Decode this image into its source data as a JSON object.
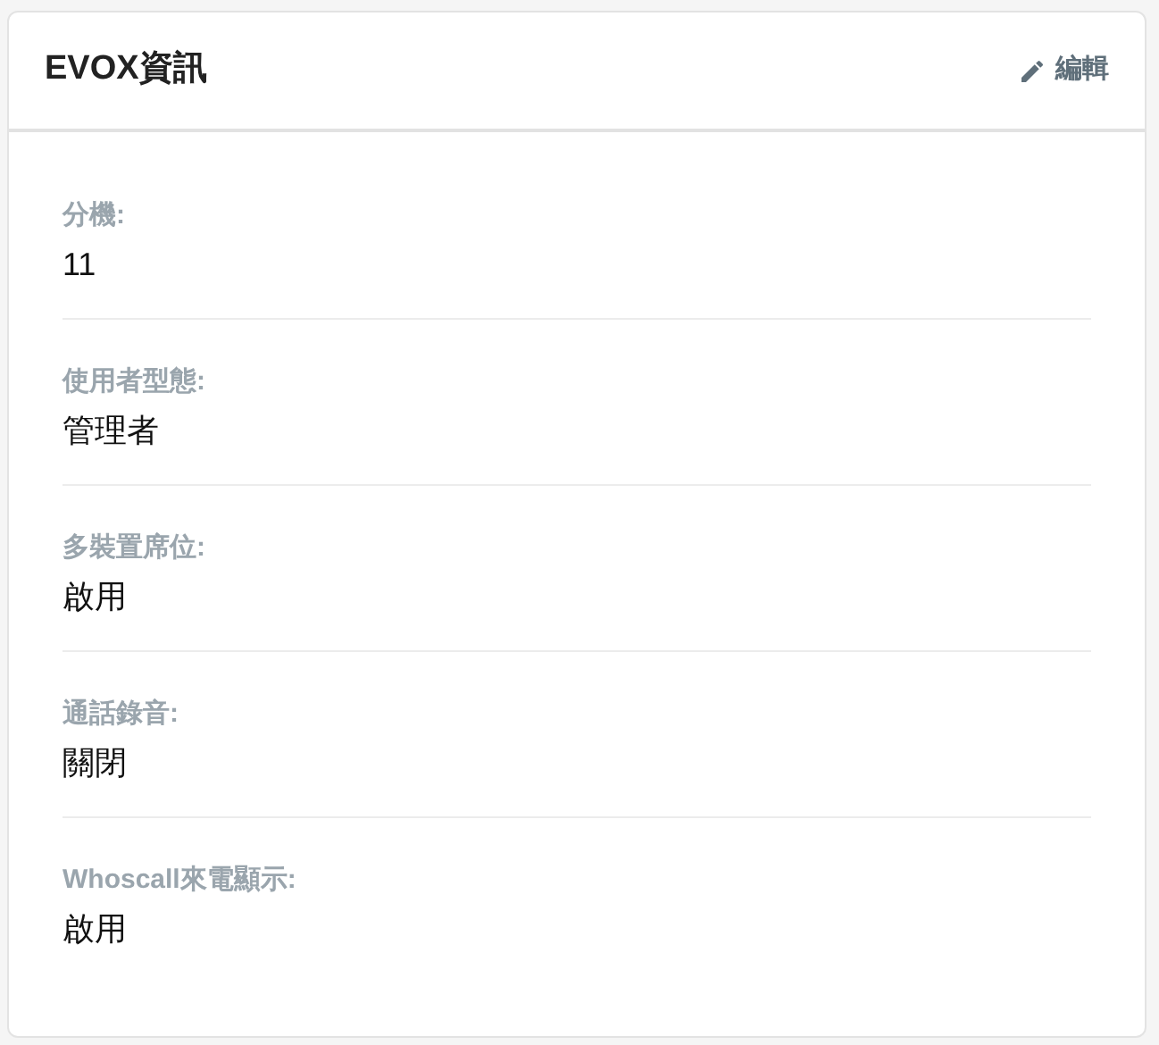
{
  "card": {
    "title": "EVOX資訊",
    "edit_button": "編輯"
  },
  "fields": [
    {
      "label": "分機:",
      "value": "11"
    },
    {
      "label": "使用者型態:",
      "value": "管理者"
    },
    {
      "label": "多裝置席位:",
      "value": "啟用"
    },
    {
      "label": "通話錄音:",
      "value": "關閉"
    },
    {
      "label": "Whoscall來電顯示:",
      "value": "啟用"
    }
  ]
}
